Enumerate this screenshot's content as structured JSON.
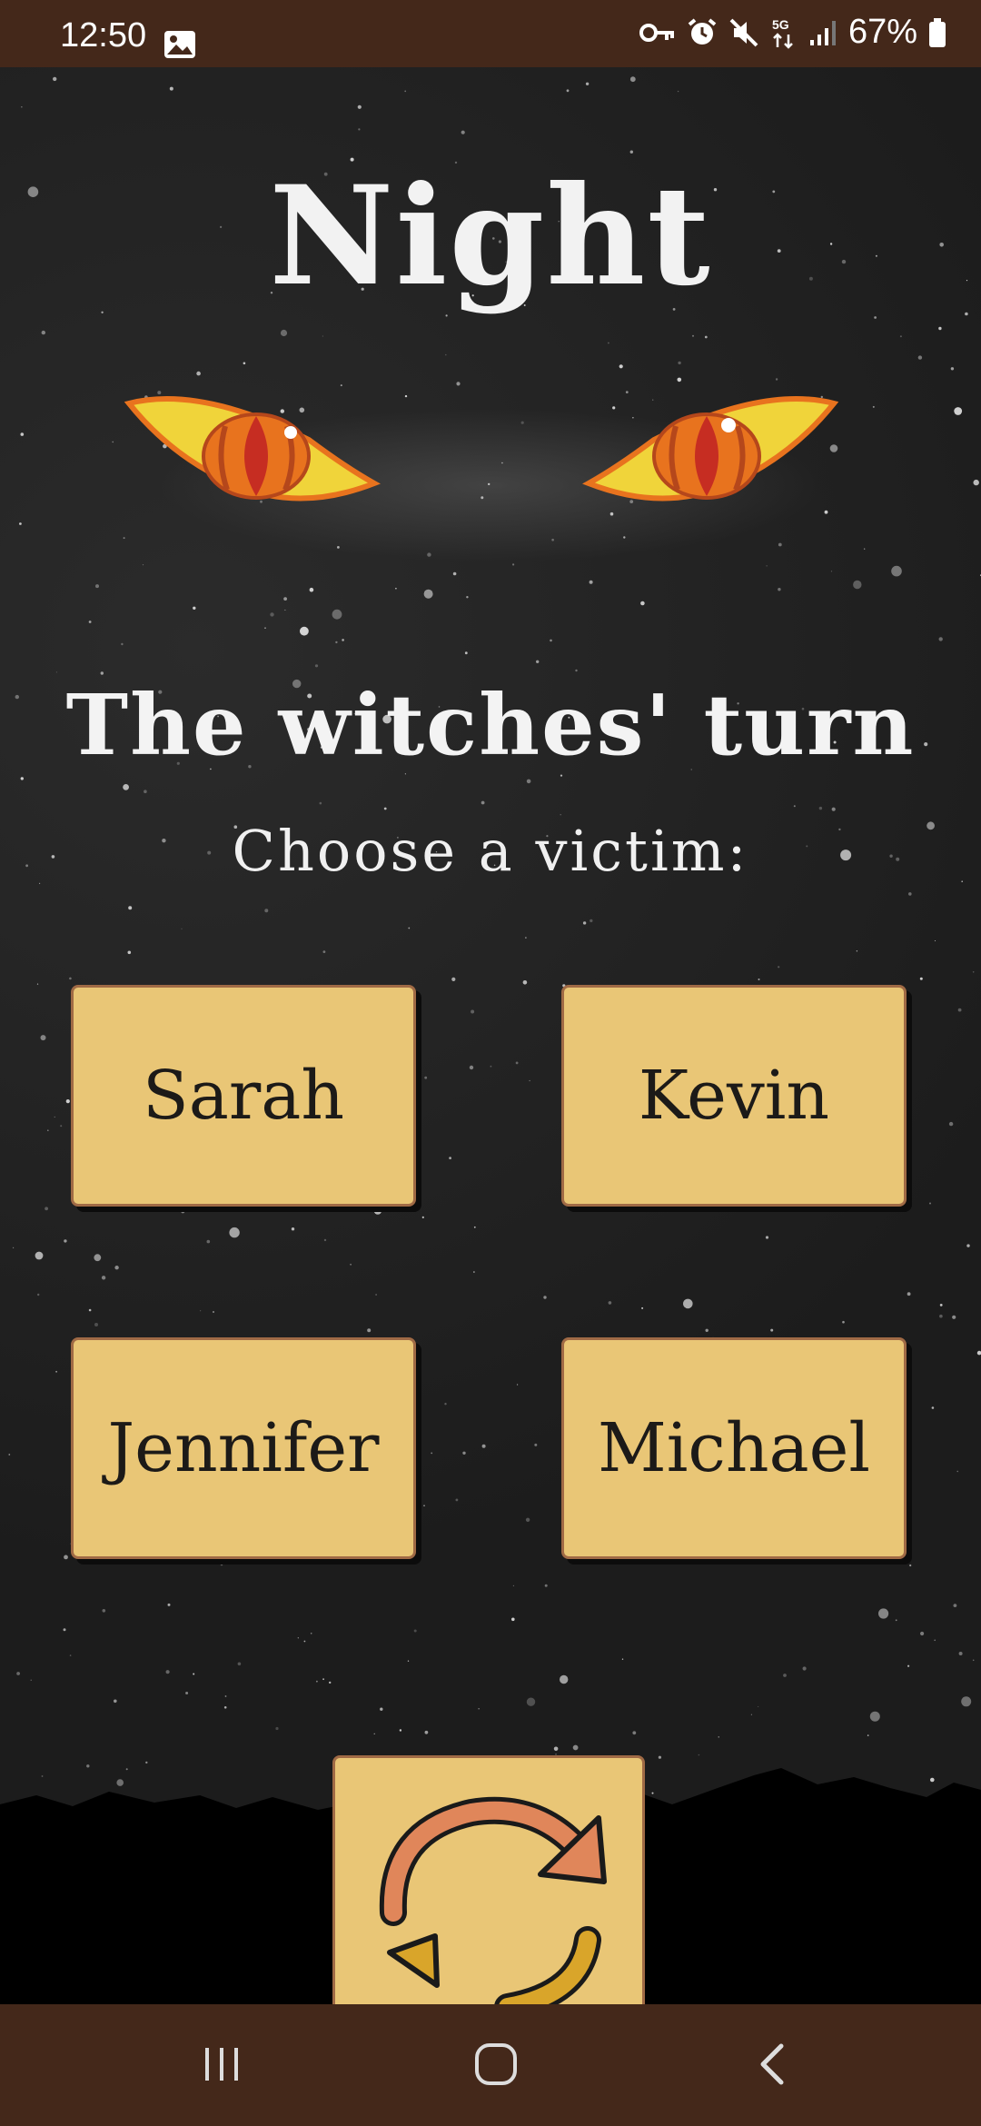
{
  "status_bar": {
    "time": "12:50",
    "battery": "67%",
    "icons": [
      "gallery-icon",
      "key-icon",
      "alarm-icon",
      "mute-icon",
      "5g-icon",
      "signal-icon",
      "battery-icon"
    ]
  },
  "screen": {
    "title": "Night",
    "subtitle": "The witches' turn",
    "prompt": "Choose a victim:"
  },
  "players": [
    "Sarah",
    "Kevin",
    "Jennifer",
    "Michael"
  ],
  "refresh_button": {
    "icon": "refresh-icon"
  },
  "nav_bar": {
    "icons": [
      "recent-apps-icon",
      "home-icon",
      "back-icon"
    ]
  },
  "colors": {
    "status_bar": "#44281a",
    "button_fill": "#e9c676",
    "button_border": "#a06a45",
    "eye_orange": "#e8731e",
    "eye_yellow": "#f0d43a"
  }
}
